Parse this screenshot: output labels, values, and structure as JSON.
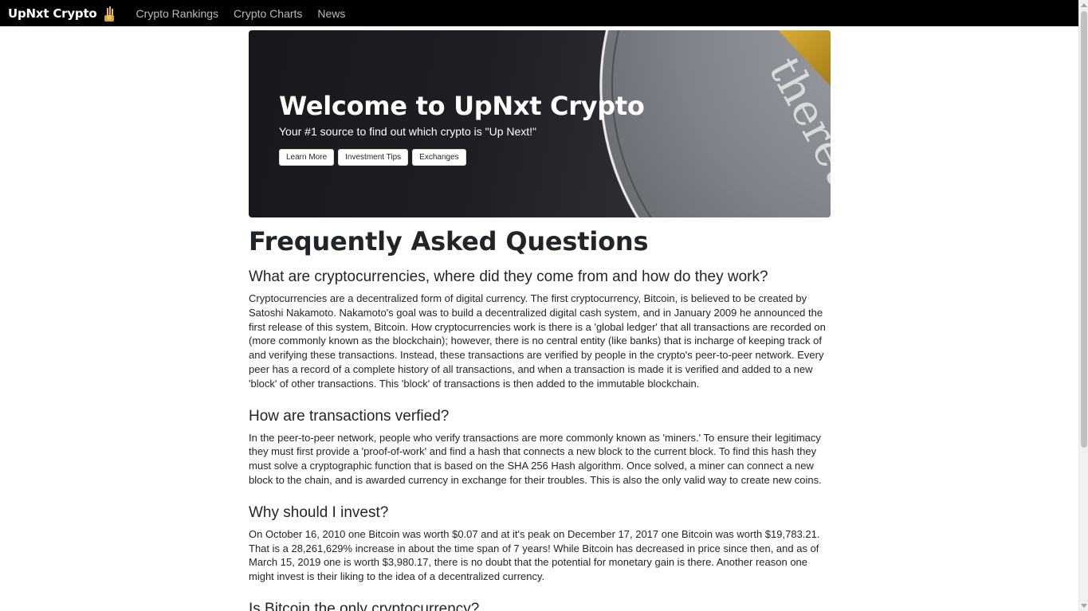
{
  "navbar": {
    "brand": "UpNxt Crypto",
    "links": [
      "Crypto Rankings",
      "Crypto Charts",
      "News"
    ]
  },
  "hero": {
    "title": "Welcome to UpNxt Crypto",
    "subtitle": "Your #1 source to find out which crypto is \"Up Next!\"",
    "buttons": [
      "Learn More",
      "Investment Tips",
      "Exchanges"
    ],
    "coin_text": "thereum"
  },
  "faq": {
    "title": "Frequently Asked Questions",
    "items": [
      {
        "question": "What are cryptocurrencies, where did they come from and how do they work?",
        "answer": "Cryptocurrencies are a decentralized form of digital currency. The first cryptocurrency, Bitcoin, is believed to be created by Satoshi Nakamoto. Nakamoto's goal was to build a decentralized digital cash system, and in January 2009 he announced the first release of this system, Bitcoin. How cryptocurrencies work is there is a 'global ledger' that all transactions are recorded on (more commonly known as the blockchain); however, there is no central entity (like banks) that is incharge of keeping track of and verifying these transactions. Instead, these transactions are verified by people in the crypto's peer-to-peer network. Every peer has a record of a complete history of all transactions, and when a transaction is made it is verified and added to a new 'block' of other transactions. This 'block' of transactions is then added to the immutable blockchain."
      },
      {
        "question": "How are transactions verfied?",
        "answer": "In the peer-to-peer network, people who verify transactions are more commonly known as 'miners.' To ensure their legitimacy they must first provide a 'proof-of-work' and find a hash that connects a new block to the current block. To find this hash they must solve a cryptographic function that is based on the SHA 256 Hash algorithm. Once solved, a miner can connect a new block to the chain, and is awarded currency in exchange for their troubles. This is also the only valid way to create new coins."
      },
      {
        "question": "Why should I invest?",
        "answer": "On October 16, 2010 one Bitcoin was worth $0.07 and at it's peak on December 17, 2017 one Bitcoin was worth $19,783.21. That is a 28,261,629% increase in about the time span of 7 years! While Bitcoin has decreased in price since then, and as of March 15, 2019 one is worth $3,980.17, there is no doubt that the potential for monetary gain is there. Another reason one might invest is their liking to the idea of a decentralized currency."
      },
      {
        "question": "Is Bitcoin the only cryptocurrency?",
        "answer": ""
      }
    ]
  },
  "colors": {
    "navbar_bg": "#000000",
    "nav_link": "#b8b8b8",
    "hero_bg": "#1e1f24",
    "coin_silver": "#8a8e93",
    "coin_gold": "#c9a227"
  },
  "icons": {
    "brand_logo": "bitcoin-hand-icon"
  }
}
